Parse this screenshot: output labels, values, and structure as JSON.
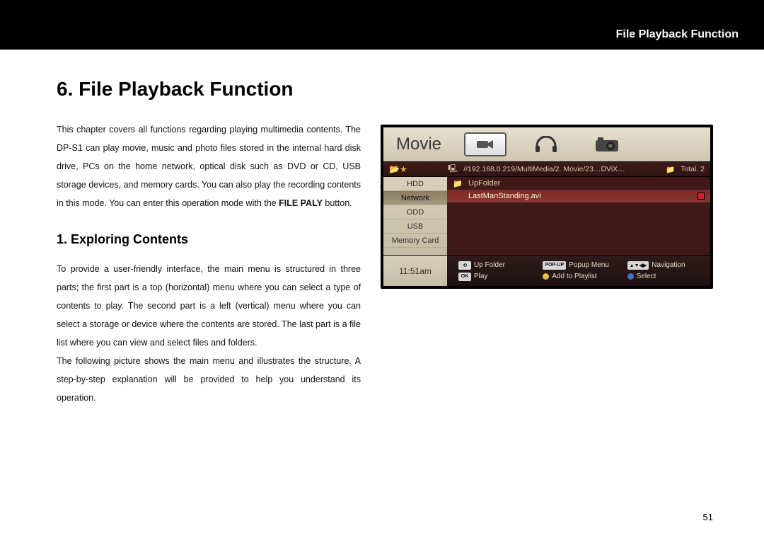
{
  "header_title": "File Playback Function",
  "h1": "6. File Playback Function",
  "para1_a": "This chapter covers all functions regarding playing multimedia contents. The DP-S1 can play movie, music and photo files stored in the internal hard disk drive, PCs on the home network, optical disk such as DVD or CD, USB storage devices, and memory cards. You can also play the recording contents in this mode. You can enter this operation mode with the ",
  "para1_bold": "FILE PALY",
  "para1_b": " button.",
  "h2": "1. Exploring Contents",
  "para2": "To provide a user-friendly interface, the main menu is structured in three parts; the first part is a top (horizontal) menu where you can select a type of contents to play. The second part is a left (vertical) menu where you can select a storage or device where the contents are stored. The last part is a file list where you can view and select files and folders.",
  "para3": "The following picture shows the main menu and illustrates the structure. A step-by-step explanation will be provided to help you understand its operation.",
  "page_number": "51",
  "device": {
    "top_title": "Movie",
    "path": "//192.168.0.219/MultiMedia/2. Movie/23…DViX…",
    "total_label": "Total. 2",
    "side_items": [
      "HDD",
      "Network",
      "ODD",
      "USB",
      "Memory Card"
    ],
    "side_selected_index": 1,
    "files": [
      {
        "icon": "folder",
        "name": "UpFolder",
        "selected": false
      },
      {
        "icon": "file",
        "name": "LastManStanding.avi",
        "selected": true
      }
    ],
    "clock": "11:51am",
    "hints": {
      "up_folder": "Up Folder",
      "play": "Play",
      "popup": "Popup Menu",
      "add": "Add to Playlist",
      "nav": "Navigation",
      "select": "Select"
    }
  }
}
